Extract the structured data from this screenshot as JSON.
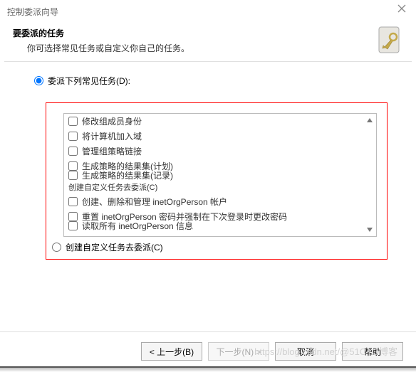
{
  "titlebar": {
    "text": "控制委派向导"
  },
  "header": {
    "title": "要委派的任务",
    "desc": "你可选择常见任务或自定义你自己的任务。"
  },
  "options": {
    "delegate_common": {
      "label": "委派下列常见任务(D):",
      "checked": true
    },
    "custom_task": {
      "label": "创建自定义任务去委派(C)",
      "checked": false
    }
  },
  "tasks": {
    "items": [
      {
        "label": "修改组成员身份"
      },
      {
        "label": "将计算机加入域"
      },
      {
        "label": "管理组策略链接"
      },
      {
        "label": "生成策略的结果集(计划)"
      },
      {
        "label": "生成策略的结果集(记录)"
      },
      {
        "label": "创建自定义任务去委派(C)"
      },
      {
        "label": "创建、删除和管理 inetOrgPerson 帐户"
      },
      {
        "label": "重置 inetOrgPerson 密码并强制在下次登录时更改密码"
      },
      {
        "label": "读取所有 inetOrgPerson 信息"
      }
    ]
  },
  "buttons": {
    "back": "< 上一步(B)",
    "next": "下一步(N) >",
    "cancel": "取消",
    "help": "帮助"
  },
  "watermark": "https://blog.csdn.net/@51CTO博客"
}
